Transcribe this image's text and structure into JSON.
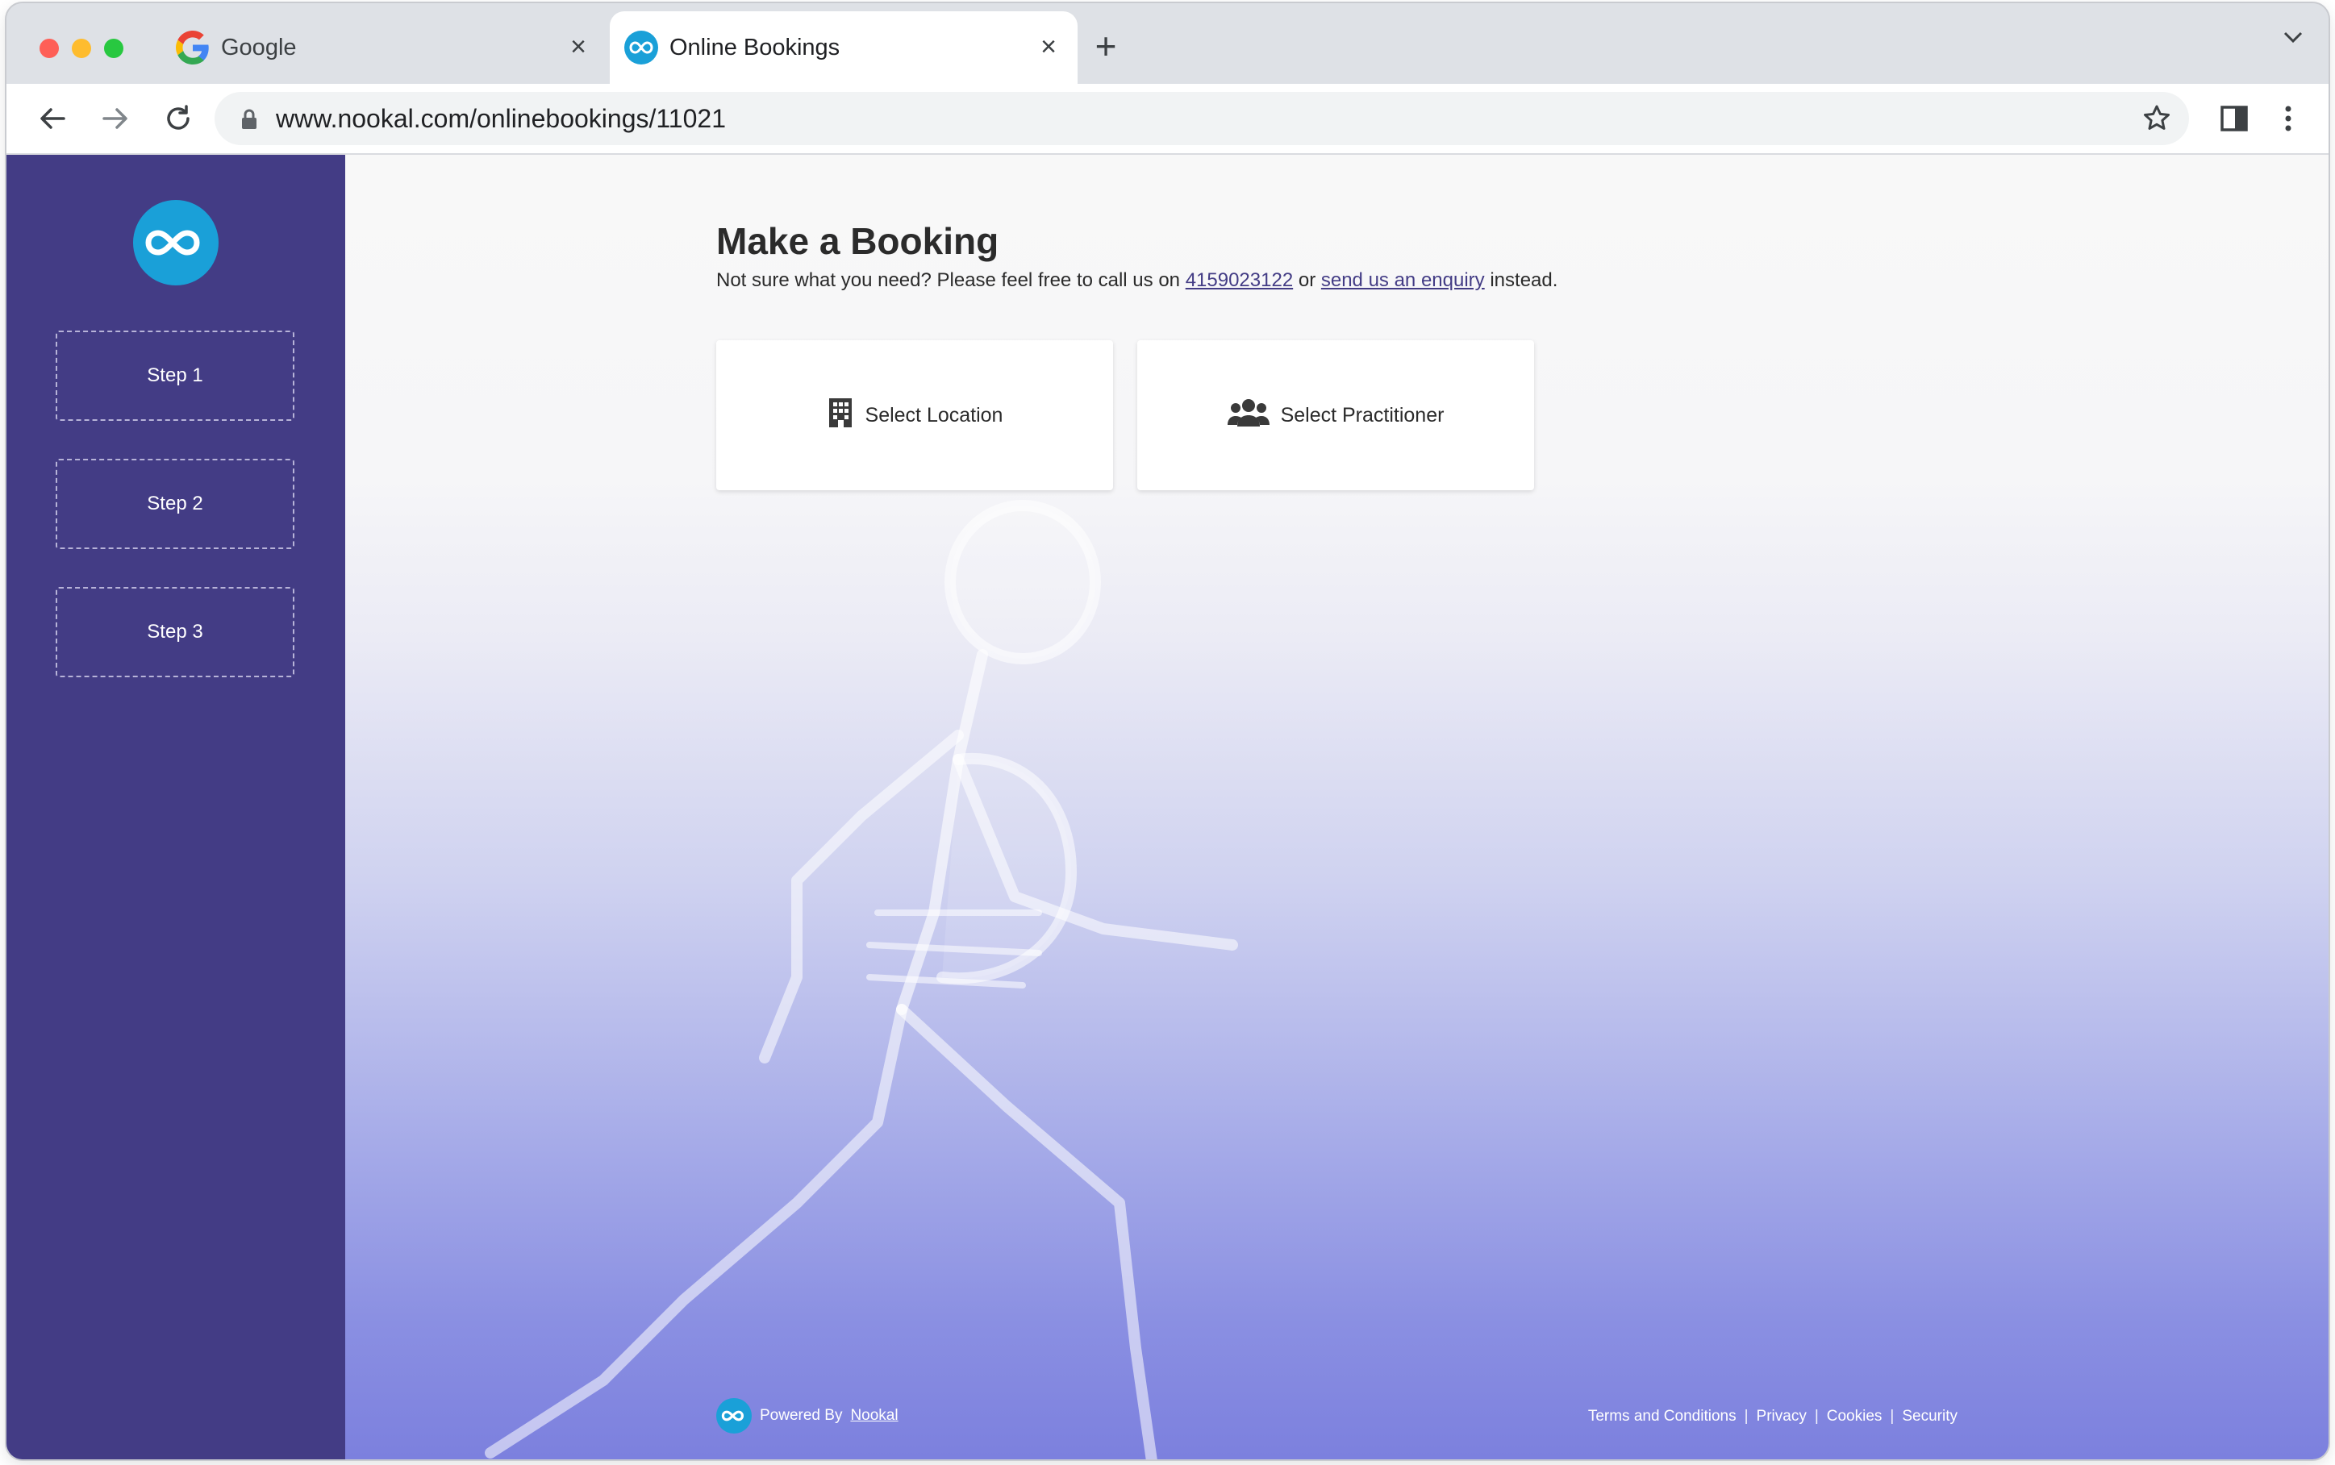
{
  "browser": {
    "tabs": [
      {
        "title": "Google",
        "active": false,
        "favicon": "google-g-icon"
      },
      {
        "title": "Online Bookings",
        "active": true,
        "favicon": "nookal-infinity-icon"
      }
    ],
    "new_tab_label": "+",
    "url": "www.nookal.com/onlinebookings/11021"
  },
  "sidebar": {
    "steps": [
      {
        "label": "Step 1"
      },
      {
        "label": "Step 2"
      },
      {
        "label": "Step 3"
      }
    ]
  },
  "main": {
    "heading": "Make a Booking",
    "subtext_prefix": "Not sure what you need? Please feel free to call us on",
    "phone": "4159023122",
    "or_text": "or",
    "enquiry_link": "send us an enquiry",
    "subtext_suffix": "instead.",
    "cards": [
      {
        "label": "Select Location",
        "icon": "building-icon"
      },
      {
        "label": "Select Practitioner",
        "icon": "users-icon"
      }
    ]
  },
  "footer": {
    "powered_by": "Powered By",
    "brand": "Nookal",
    "links": [
      "Terms and Conditions",
      "Privacy",
      "Cookies",
      "Security"
    ],
    "separator": "|"
  },
  "colors": {
    "sidebar": "#433c85",
    "brand_blue": "#1aa0d8",
    "link": "#433c85"
  }
}
